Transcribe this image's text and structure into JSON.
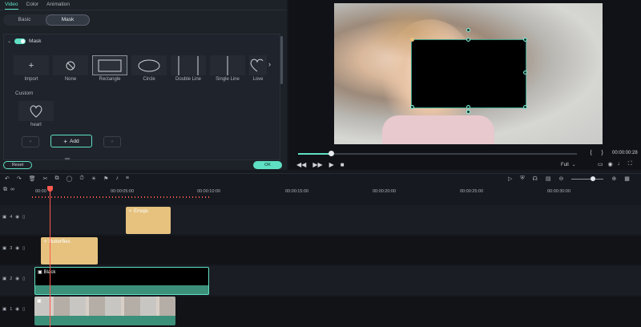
{
  "tabs": [
    "Video",
    "Color",
    "Animation"
  ],
  "subtabs": [
    "Basic",
    "Mask"
  ],
  "mask": {
    "section_title": "Mask",
    "items": [
      {
        "label": "Import",
        "icon": "plus-icon"
      },
      {
        "label": "None",
        "icon": "none-icon"
      },
      {
        "label": "Rectangle",
        "icon": "rectangle-icon"
      },
      {
        "label": "Circle",
        "icon": "circle-icon"
      },
      {
        "label": "Double Line",
        "icon": "double-line-icon"
      },
      {
        "label": "Single Line",
        "icon": "single-line-icon"
      },
      {
        "label": "Love",
        "icon": "love-icon"
      }
    ],
    "custom_label": "Custom",
    "custom_items": [
      {
        "label": "heart",
        "icon": "heart-icon"
      }
    ],
    "add_label": "Add"
  },
  "footer": {
    "reset_label": "Reset",
    "ok_label": "OK"
  },
  "preview": {
    "time_display": "00:00:00:28",
    "quality": "Full",
    "progress": 0.12
  },
  "ruler": [
    "00:00",
    "00:00:05:00",
    "00:00:10:00",
    "00:00:15:00",
    "00:00:20:00",
    "00:00:25:00",
    "00:00:30:00"
  ],
  "tracks": [
    {
      "num": "4",
      "clip": "Emojis"
    },
    {
      "num": "3",
      "clip": "Butterflies"
    },
    {
      "num": "2",
      "clip": "Black"
    },
    {
      "num": "1",
      "clip": ""
    }
  ],
  "colors": {
    "accent": "#5fe0c4",
    "playhead": "#ff5a50",
    "sticker_clip": "#e6c27e",
    "video_clip": "#3c8f78"
  }
}
